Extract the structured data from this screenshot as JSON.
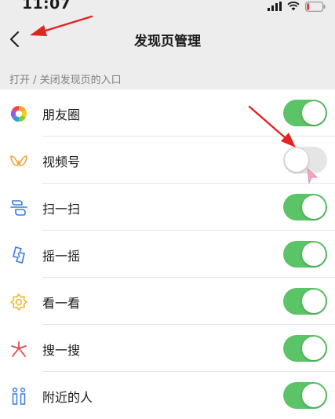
{
  "status_bar": {
    "time": "11:07"
  },
  "nav": {
    "title": "发现页管理"
  },
  "section": {
    "header": "打开 / 关闭发现页的入口"
  },
  "colors": {
    "toggle_on": "#5ac466",
    "toggle_off": "#e5e5e5",
    "annotation_arrow": "#e52222",
    "cursor": "#f0a6c3",
    "battery_low": "#e53b3b"
  },
  "items": [
    {
      "label": "朋友圈",
      "icon": "moments-icon",
      "enabled": true
    },
    {
      "label": "视频号",
      "icon": "channels-icon",
      "enabled": false
    },
    {
      "label": "扫一扫",
      "icon": "scan-icon",
      "enabled": true
    },
    {
      "label": "摇一摇",
      "icon": "shake-icon",
      "enabled": true
    },
    {
      "label": "看一看",
      "icon": "top-stories-icon",
      "enabled": true
    },
    {
      "label": "搜一搜",
      "icon": "search-icon",
      "enabled": true
    },
    {
      "label": "附近的人",
      "icon": "people-nearby-icon",
      "enabled": true
    }
  ]
}
